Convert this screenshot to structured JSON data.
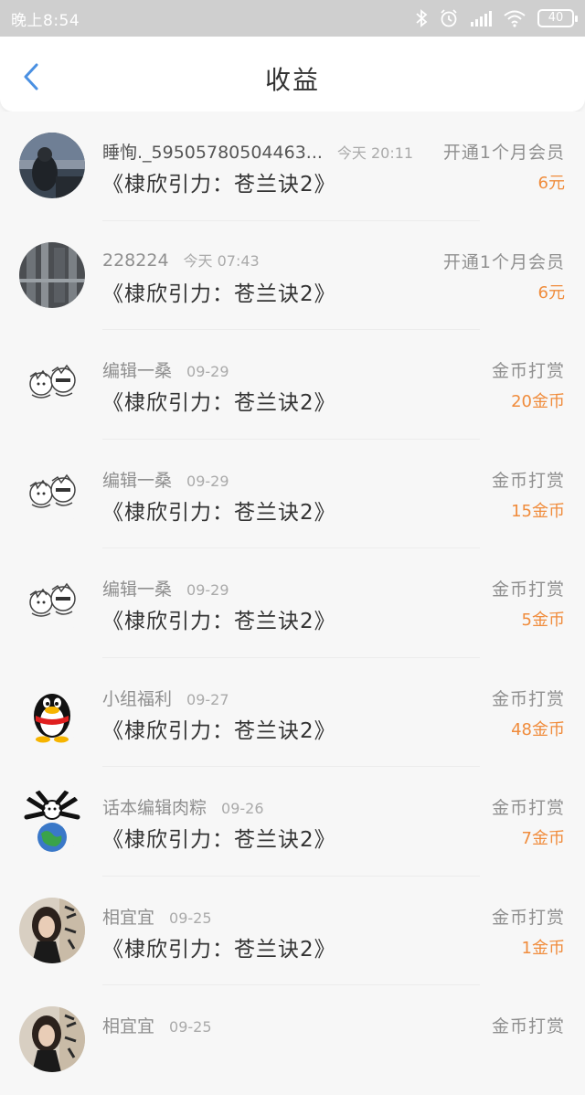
{
  "status": {
    "time": "晚上8:54",
    "battery": "40"
  },
  "header": {
    "title": "收益"
  },
  "colors": {
    "accent": "#4a90e2",
    "amount": "#f08c3c"
  },
  "items": [
    {
      "name": "睡恂._59505780504463...",
      "date": "今天 20:11",
      "book": "《棣欣引力：苍兰诀2》",
      "type": "开通1个月会员",
      "amount": "6元",
      "avatar": "photo-dusk"
    },
    {
      "name": "228224",
      "date": "今天 07:43",
      "book": "《棣欣引力：苍兰诀2》",
      "type": "开通1个月会员",
      "amount": "6元",
      "avatar": "photo-waterfall"
    },
    {
      "name": "编辑一桑",
      "date": "09-29",
      "book": "《棣欣引力：苍兰诀2》",
      "type": "金币打赏",
      "amount": "20金币",
      "avatar": "cartoon-doodle"
    },
    {
      "name": "编辑一桑",
      "date": "09-29",
      "book": "《棣欣引力：苍兰诀2》",
      "type": "金币打赏",
      "amount": "15金币",
      "avatar": "cartoon-doodle"
    },
    {
      "name": "编辑一桑",
      "date": "09-29",
      "book": "《棣欣引力：苍兰诀2》",
      "type": "金币打赏",
      "amount": "5金币",
      "avatar": "cartoon-doodle"
    },
    {
      "name": "小组福利",
      "date": "09-27",
      "book": "《棣欣引力：苍兰诀2》",
      "type": "金币打赏",
      "amount": "48金币",
      "avatar": "qq-penguin"
    },
    {
      "name": "话本编辑肉粽",
      "date": "09-26",
      "book": "《棣欣引力：苍兰诀2》",
      "type": "金币打赏",
      "amount": "7金币",
      "avatar": "earth-cartoon"
    },
    {
      "name": "相宜宜",
      "date": "09-25",
      "book": "《棣欣引力：苍兰诀2》",
      "type": "金币打赏",
      "amount": "1金币",
      "avatar": "photo-girl"
    },
    {
      "name": "相宜宜",
      "date": "09-25",
      "book": "",
      "type": "金币打赏",
      "amount": "",
      "avatar": "photo-girl"
    }
  ]
}
